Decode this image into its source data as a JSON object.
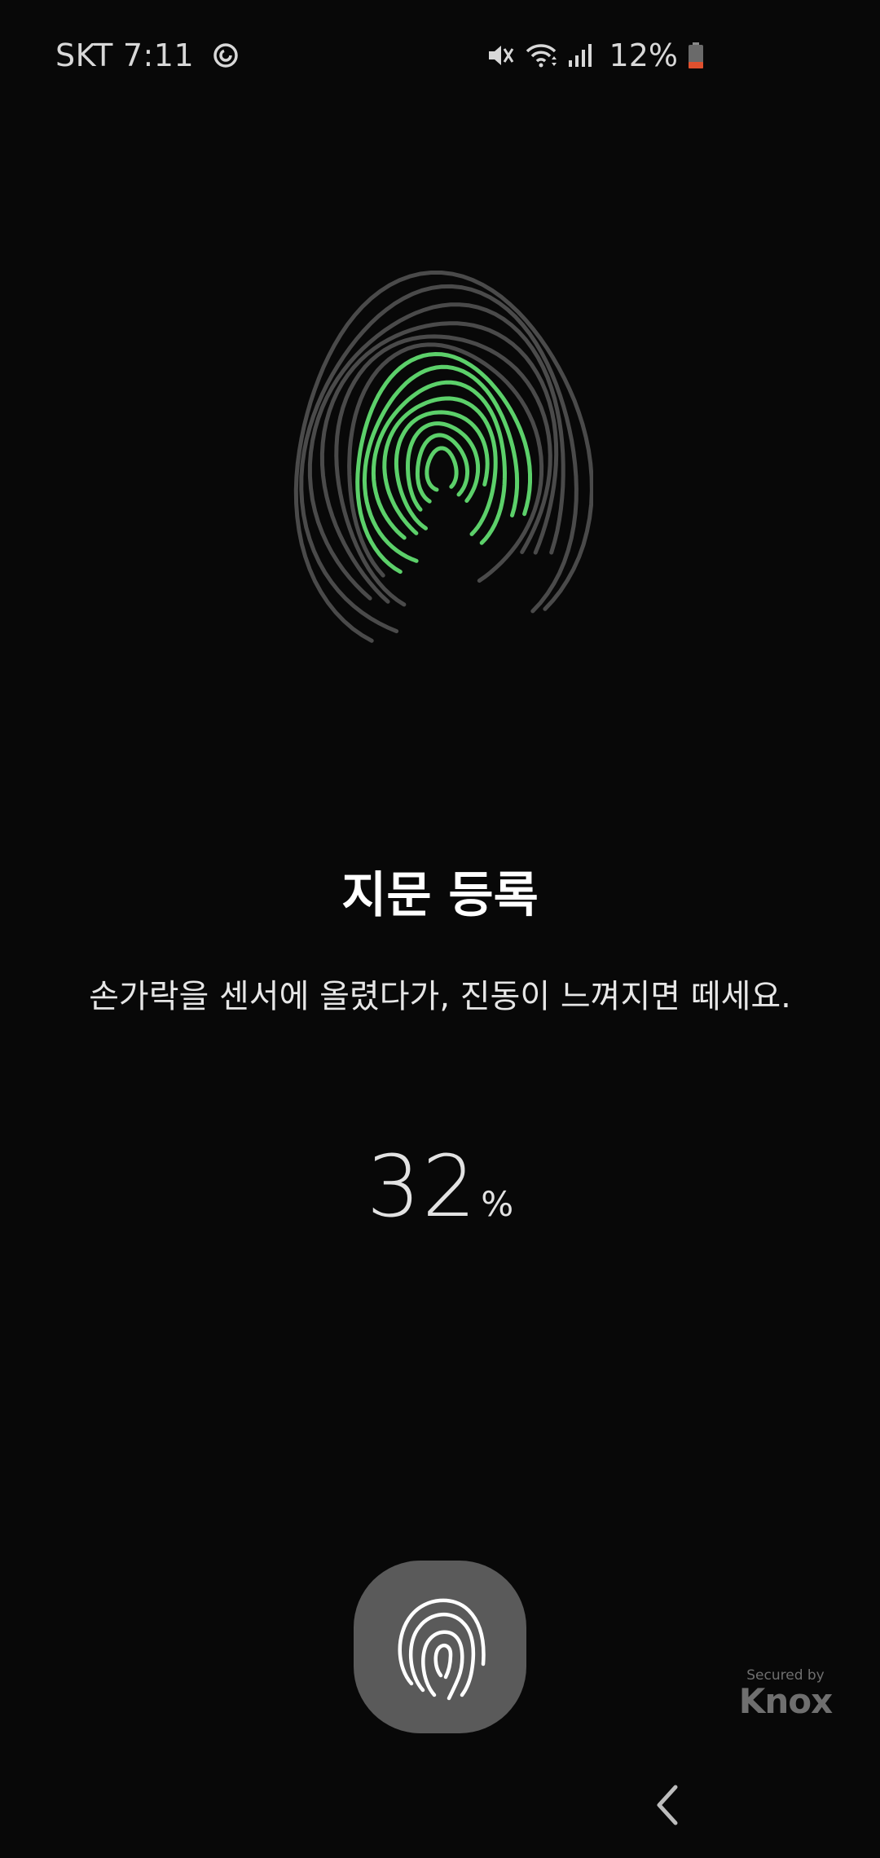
{
  "status_bar": {
    "carrier": "SKT",
    "time": "7:11",
    "battery_percent": "12%",
    "icons": [
      "sync-icon",
      "mute-icon",
      "wifi-icon",
      "signal-icon",
      "battery-icon"
    ]
  },
  "enrollment": {
    "title": "지문 등록",
    "instruction": "손가락을 센서에 올렸다가, 진동이 느껴지면 떼세요.",
    "progress_value": "32",
    "progress_unit": "%",
    "progress_fraction": 0.32
  },
  "badge": {
    "small": "Secured by",
    "big": "Knox"
  },
  "nav": {
    "back_icon": "chevron-left-icon"
  },
  "colors": {
    "background": "#080808",
    "ridge_gray": "#4a4a4a",
    "ridge_green": "#5cd06a",
    "sensor_button": "#5a5a5a",
    "battery_low": "#e0502e"
  }
}
